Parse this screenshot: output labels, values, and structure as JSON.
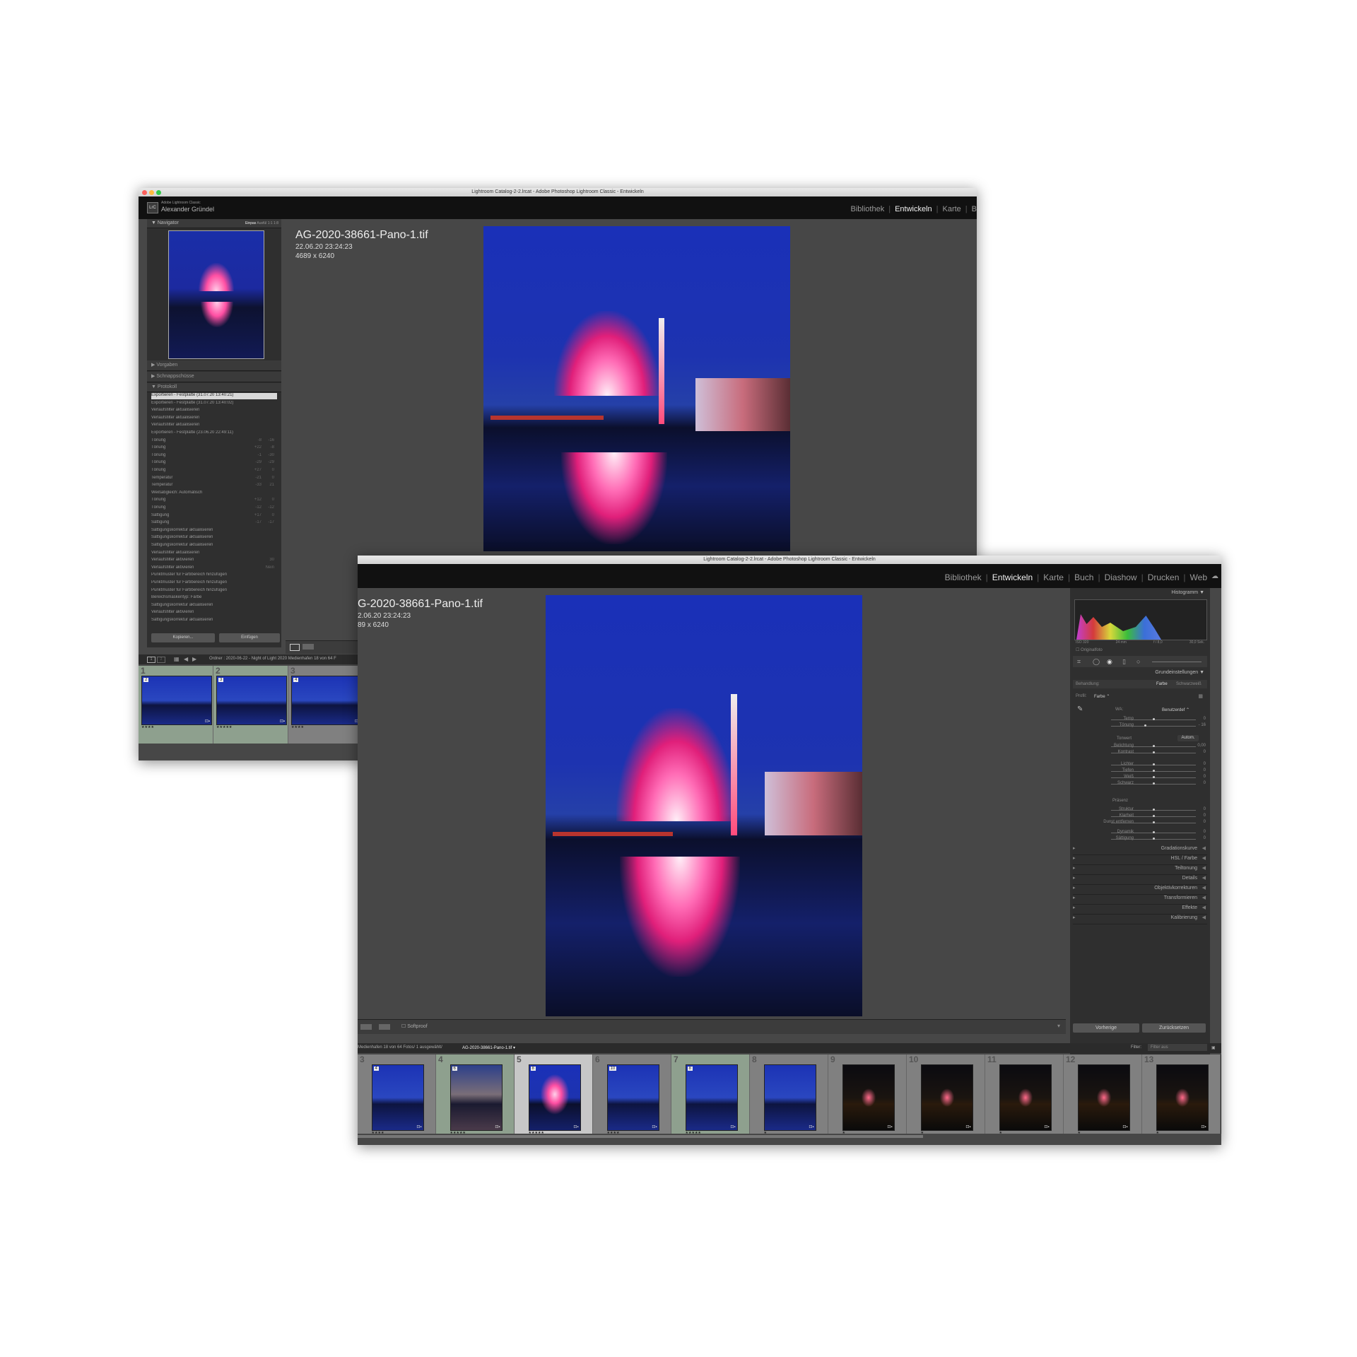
{
  "window_back": {
    "title": "Lightroom Catalog-2-2.lrcat - Adobe Photoshop Lightroom Classic - Entwickeln",
    "identity": {
      "app": "Adobe Lightroom Classic",
      "user": "Alexander Gründel"
    },
    "modules": [
      "Bibliothek",
      "Entwickeln",
      "Karte",
      "B"
    ],
    "active_module": "Entwickeln",
    "photo_info": {
      "filename": "AG-2020-38661-Pano-1.tif",
      "date": "22.06.20 23:24:23",
      "size": "4689 x 6240"
    },
    "navigator": {
      "label": "Navigator",
      "modes": [
        "Einpas",
        "Ausfül",
        "1:1",
        "1:8"
      ]
    },
    "panels": [
      {
        "label": "Vorgaben"
      },
      {
        "label": "Schnappschüsse"
      },
      {
        "label": "Protokoll"
      }
    ],
    "history": [
      {
        "text": "Exportieren - Festplatte (31.07.20 13:40:21)",
        "a": "",
        "b": "",
        "selected": true
      },
      {
        "text": "Exportieren - Festplatte (31.07.20 13:40:02)",
        "a": "",
        "b": ""
      },
      {
        "text": "Verlaufsfilter aktualisieren",
        "a": "",
        "b": ""
      },
      {
        "text": "Verlaufsfilter aktualisieren",
        "a": "",
        "b": ""
      },
      {
        "text": "Verlaufsfilter aktualisieren",
        "a": "",
        "b": ""
      },
      {
        "text": "Exportieren - Festplatte (23.06.20 22:49:11)",
        "a": "",
        "b": ""
      },
      {
        "text": "Tönung",
        "a": "-8",
        "b": "-16"
      },
      {
        "text": "Tönung",
        "a": "+22",
        "b": "-8"
      },
      {
        "text": "Tönung",
        "a": "-1",
        "b": "-30"
      },
      {
        "text": "Tönung",
        "a": "-29",
        "b": "-29"
      },
      {
        "text": "Tönung",
        "a": "+27",
        "b": "0"
      },
      {
        "text": "Temperatur",
        "a": "-21",
        "b": "0"
      },
      {
        "text": "Temperatur",
        "a": "-33",
        "b": "21"
      },
      {
        "text": "Weißabgleich: Automatisch",
        "a": "",
        "b": ""
      },
      {
        "text": "Tönung",
        "a": "+12",
        "b": "0"
      },
      {
        "text": "Tönung",
        "a": "-12",
        "b": "-12"
      },
      {
        "text": "Sättigung",
        "a": "+17",
        "b": "0"
      },
      {
        "text": "Sättigung",
        "a": "-17",
        "b": "-17"
      },
      {
        "text": "Sättigungskorrektur aktualisieren",
        "a": "",
        "b": ""
      },
      {
        "text": "Sättigungskorrektur aktualisieren",
        "a": "",
        "b": ""
      },
      {
        "text": "Sättigungskorrektur aktualisieren",
        "a": "",
        "b": ""
      },
      {
        "text": "Verlaufsfilter aktualisieren",
        "a": "",
        "b": ""
      },
      {
        "text": "Verlaufsfilter aktivieren",
        "a": "",
        "b": "30"
      },
      {
        "text": "Verlaufsfilter aktivieren",
        "a": "",
        "b": "Nein"
      },
      {
        "text": "Punktmuster für Farbbereich hinzufügen",
        "a": "",
        "b": ""
      },
      {
        "text": "Punktmuster für Farbbereich hinzufügen",
        "a": "",
        "b": ""
      },
      {
        "text": "Punktmuster für Farbbereich hinzufügen",
        "a": "",
        "b": ""
      },
      {
        "text": "Bereichsmaskentyp: Farbe",
        "a": "",
        "b": ""
      },
      {
        "text": "Sättigungskorrektur aktualisieren",
        "a": "",
        "b": ""
      },
      {
        "text": "Verlaufsfilter aktivieren",
        "a": "",
        "b": ""
      },
      {
        "text": "Sättigungskorrektur aktualisieren",
        "a": "",
        "b": ""
      }
    ],
    "buttons": {
      "copy": "Kopieren...",
      "paste": "Einfügen"
    },
    "filmstrip_bar": "Ordner : 2020-06-22 - Night of Light 2020 Medienhafen   18 von 64 F",
    "thumbs": [
      {
        "num": "1",
        "badge": "2",
        "stars": "★★★★"
      },
      {
        "num": "2",
        "badge": "3",
        "stars": "★★★★★"
      },
      {
        "num": "3",
        "badge": "4",
        "stars": "★★★★"
      }
    ]
  },
  "window_front": {
    "title": "Lightroom Catalog-2-2.lrcat - Adobe Photoshop Lightroom Classic - Entwickeln",
    "modules": [
      "Bibliothek",
      "Entwickeln",
      "Karte",
      "Buch",
      "Diashow",
      "Drucken",
      "Web"
    ],
    "active_module": "Entwickeln",
    "photo_info": {
      "filename": "G-2020-38661-Pano-1.tif",
      "date": "2.06.20 23:24:23",
      "size": "89 x 6240"
    },
    "histogram": {
      "label": "Histogramm",
      "meta": [
        "ISO 320",
        "24 mm",
        "f / 8,0",
        "30,0 Sek."
      ],
      "original_photo": "Originalfoto"
    },
    "basic": {
      "label": "Grundeinstellungen",
      "treatment_label": "Behandlung:",
      "treatment_options": [
        "Farbe",
        "Schwarzweiß"
      ],
      "profile_label": "Profil:",
      "profile_value": "Farbe",
      "wb_label": "WA:",
      "wb_value": "Benutzerdef",
      "tone_label": "Tonwert",
      "auto": "Autom.",
      "presence_label": "Präsenz",
      "sliders_wb": [
        {
          "name": "Temp",
          "value": "0",
          "pos": 0.5
        },
        {
          "name": "Tönung",
          "value": "- 16",
          "pos": 0.4
        }
      ],
      "sliders_tone": [
        {
          "name": "Belichtung",
          "value": "0,00",
          "pos": 0.5
        },
        {
          "name": "Kontrast",
          "value": "0",
          "pos": 0.5
        }
      ],
      "sliders_tone2": [
        {
          "name": "Lichter",
          "value": "0",
          "pos": 0.5
        },
        {
          "name": "Tiefen",
          "value": "0",
          "pos": 0.5
        },
        {
          "name": "Weiß",
          "value": "0",
          "pos": 0.5
        },
        {
          "name": "Schwarz",
          "value": "0",
          "pos": 0.5
        }
      ],
      "sliders_presence": [
        {
          "name": "Struktur",
          "value": "0",
          "pos": 0.5
        },
        {
          "name": "Klarheit",
          "value": "0",
          "pos": 0.5
        },
        {
          "name": "Dunst entfernen",
          "value": "0",
          "pos": 0.5
        }
      ],
      "sliders_presence2": [
        {
          "name": "Dynamik",
          "value": "0",
          "pos": 0.5
        },
        {
          "name": "Sättigung",
          "value": "0",
          "pos": 0.5
        }
      ]
    },
    "sections": [
      {
        "label": "Gradationskurve"
      },
      {
        "label": "HSL / Farbe"
      },
      {
        "label": "Teiltonung"
      },
      {
        "label": "Details"
      },
      {
        "label": "Objektivkorrekturen"
      },
      {
        "label": "Transformieren"
      },
      {
        "label": "Effekte"
      },
      {
        "label": "Kalibrierung"
      }
    ],
    "buttons": {
      "previous": "Vorherige",
      "reset": "Zurücksetzen"
    },
    "toolbar": {
      "softproof": "Softproof"
    },
    "filmstrip_bar": {
      "path": "Medienhafen   18 von 64 Fotos/  1 ausgewählt/",
      "file": "AG-2020-38661-Pano-1.tif",
      "filter_label": "Filter:",
      "filter_value": "Filter aus"
    },
    "thumbs": [
      {
        "num": "3",
        "badge": "4",
        "stars": "★★★★",
        "state": "normal",
        "kind": "blue"
      },
      {
        "num": "4",
        "badge": "6",
        "stars": "★★★★★",
        "state": "pick",
        "kind": "warm"
      },
      {
        "num": "5",
        "badge": "8",
        "stars": "★★★★★",
        "state": "sel",
        "kind": "fire"
      },
      {
        "num": "6",
        "badge": "10",
        "stars": "★★★★",
        "state": "normal",
        "kind": "blue"
      },
      {
        "num": "7",
        "badge": "8",
        "stars": "★★★★★",
        "state": "pick",
        "kind": "blue"
      },
      {
        "num": "8",
        "badge": "",
        "stars": "★",
        "state": "normal",
        "kind": "blue"
      },
      {
        "num": "9",
        "badge": "",
        "stars": "★",
        "state": "normal",
        "kind": "dark"
      },
      {
        "num": "10",
        "badge": "",
        "stars": "★",
        "state": "normal",
        "kind": "dark"
      },
      {
        "num": "11",
        "badge": "",
        "stars": "★",
        "state": "normal",
        "kind": "dark"
      },
      {
        "num": "12",
        "badge": "",
        "stars": "★",
        "state": "normal",
        "kind": "dark"
      },
      {
        "num": "13",
        "badge": "",
        "stars": "★",
        "state": "normal",
        "kind": "dark"
      }
    ]
  },
  "colors": {
    "accent": "#f0f0f0",
    "panel": "#2f2f2f",
    "background": "#474747",
    "selected_thumb": "#c7c7c7",
    "picked_thumb": "#8ea08e"
  }
}
